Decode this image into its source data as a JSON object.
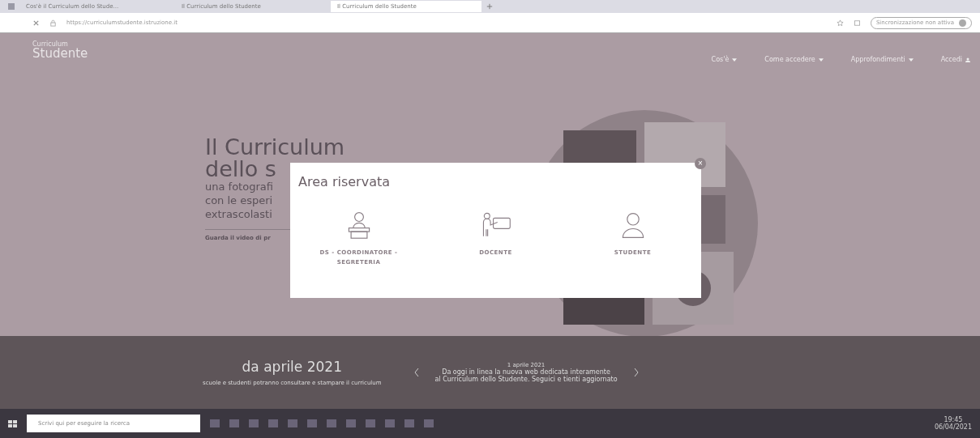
{
  "browser": {
    "tabs": [
      {
        "label": "Cos'è il Curriculum dello Stude...",
        "selected": false
      },
      {
        "label": "Il Curriculum dello Studente",
        "selected": false
      },
      {
        "label": "Il Curriculum dello Studente",
        "selected": true
      }
    ],
    "url": "https://curriculumstudente.istruzione.it",
    "profile": "Sincronizzazione non attiva"
  },
  "site": {
    "logo_top": "Curriculum",
    "logo_bottom": "Studente",
    "nav": [
      {
        "label": "Cos'è",
        "caret": true
      },
      {
        "label": "Come accedere",
        "caret": true
      },
      {
        "label": "Approfondimenti",
        "caret": true
      },
      {
        "label": "Accedi",
        "caret": false
      }
    ],
    "hero": {
      "title_1": "Il Curriculum",
      "title_2": "dello s",
      "lines": [
        "una fotografi",
        "con le esperi",
        "extrascolasti"
      ],
      "link": "Guarda il video di pr"
    },
    "band": {
      "title": "da aprile 2021",
      "subtitle": "scuole e studenti potranno consultare e stampare il curriculum",
      "news_date": "1 aprile 2021",
      "news_lines": [
        "Da oggi in linea la nuova web dedicata interamente",
        "al Curriculum dello Studente. Seguici e tienti aggiornato"
      ]
    }
  },
  "modal": {
    "title": "Area riservata",
    "close": "×",
    "options": [
      {
        "label": "DS - COORDINATORE - SEGRETERIA",
        "kind": "desk"
      },
      {
        "label": "DOCENTE",
        "kind": "teacher"
      },
      {
        "label": "STUDENTE",
        "kind": "person"
      }
    ]
  },
  "taskbar": {
    "search": "Scrivi qui per eseguire la ricerca",
    "time": "19:45",
    "date": "06/04/2021"
  }
}
